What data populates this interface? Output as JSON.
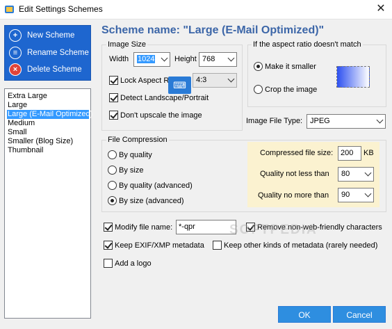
{
  "window": {
    "title": "Edit Settings Schemes",
    "close_glyph": "✕"
  },
  "side_actions": [
    {
      "label": "New Scheme",
      "icon": "new-scheme-icon"
    },
    {
      "label": "Rename Scheme",
      "icon": "rename-scheme-icon"
    },
    {
      "label": "Delete Scheme",
      "icon": "delete-scheme-icon"
    }
  ],
  "schemes": {
    "items": [
      "Extra Large",
      "Large",
      "Large (E-Mail Optimized)",
      "Medium",
      "Small",
      "Smaller (Blog Size)",
      "Thumbnail"
    ],
    "selected": "Large (E-Mail Optimized)"
  },
  "header": {
    "scheme_name": "Scheme name: \"Large (E-Mail Optimized)\""
  },
  "image_size": {
    "legend": "Image Size",
    "width_label": "Width",
    "width_value": "1024",
    "height_label": "Height",
    "height_value": "768",
    "lock_aspect_label": "Lock Aspect Ratio:",
    "lock_aspect_checked": true,
    "aspect_value": "4:3",
    "detect_label": "Detect Landscape/Portrait",
    "detect_checked": true,
    "no_upscale_label": "Don't upscale the image",
    "no_upscale_checked": true
  },
  "aspect_mismatch": {
    "legend": "If the aspect ratio doesn't match",
    "options": [
      "Make it smaller",
      "Crop the image"
    ],
    "selected": "Make it smaller"
  },
  "file_type": {
    "label": "Image File Type:",
    "value": "JPEG"
  },
  "compression": {
    "legend": "File Compression",
    "options": [
      "By quality",
      "By size",
      "By quality (advanced)",
      "By size (advanced)"
    ],
    "selected": "By size (advanced)",
    "file_size_label": "Compressed file size:",
    "file_size_value": "200",
    "file_size_unit": "KB",
    "quality_min_label": "Quality not less than",
    "quality_min_value": "80",
    "quality_max_label": "Quality no more than",
    "quality_max_value": "90"
  },
  "options": {
    "modify_name_label": "Modify file name:",
    "modify_name_checked": true,
    "modify_name_value": "*-qpr",
    "remove_chars_label": "Remove non-web-friendly characters",
    "remove_chars_checked": true,
    "keep_exif_label": "Keep EXIF/XMP metadata",
    "keep_exif_checked": true,
    "keep_other_label": "Keep other kinds of metadata (rarely needed)",
    "keep_other_checked": false,
    "add_logo_label": "Add a logo",
    "add_logo_checked": false
  },
  "watermark": "SOFTPEDIA",
  "buttons": {
    "ok": "OK",
    "cancel": "Cancel"
  },
  "colors": {
    "accent": "#1e66cf",
    "button": "#2e8ee0",
    "heading": "#3c66a8",
    "highlight_panel": "#fbf2d0"
  }
}
